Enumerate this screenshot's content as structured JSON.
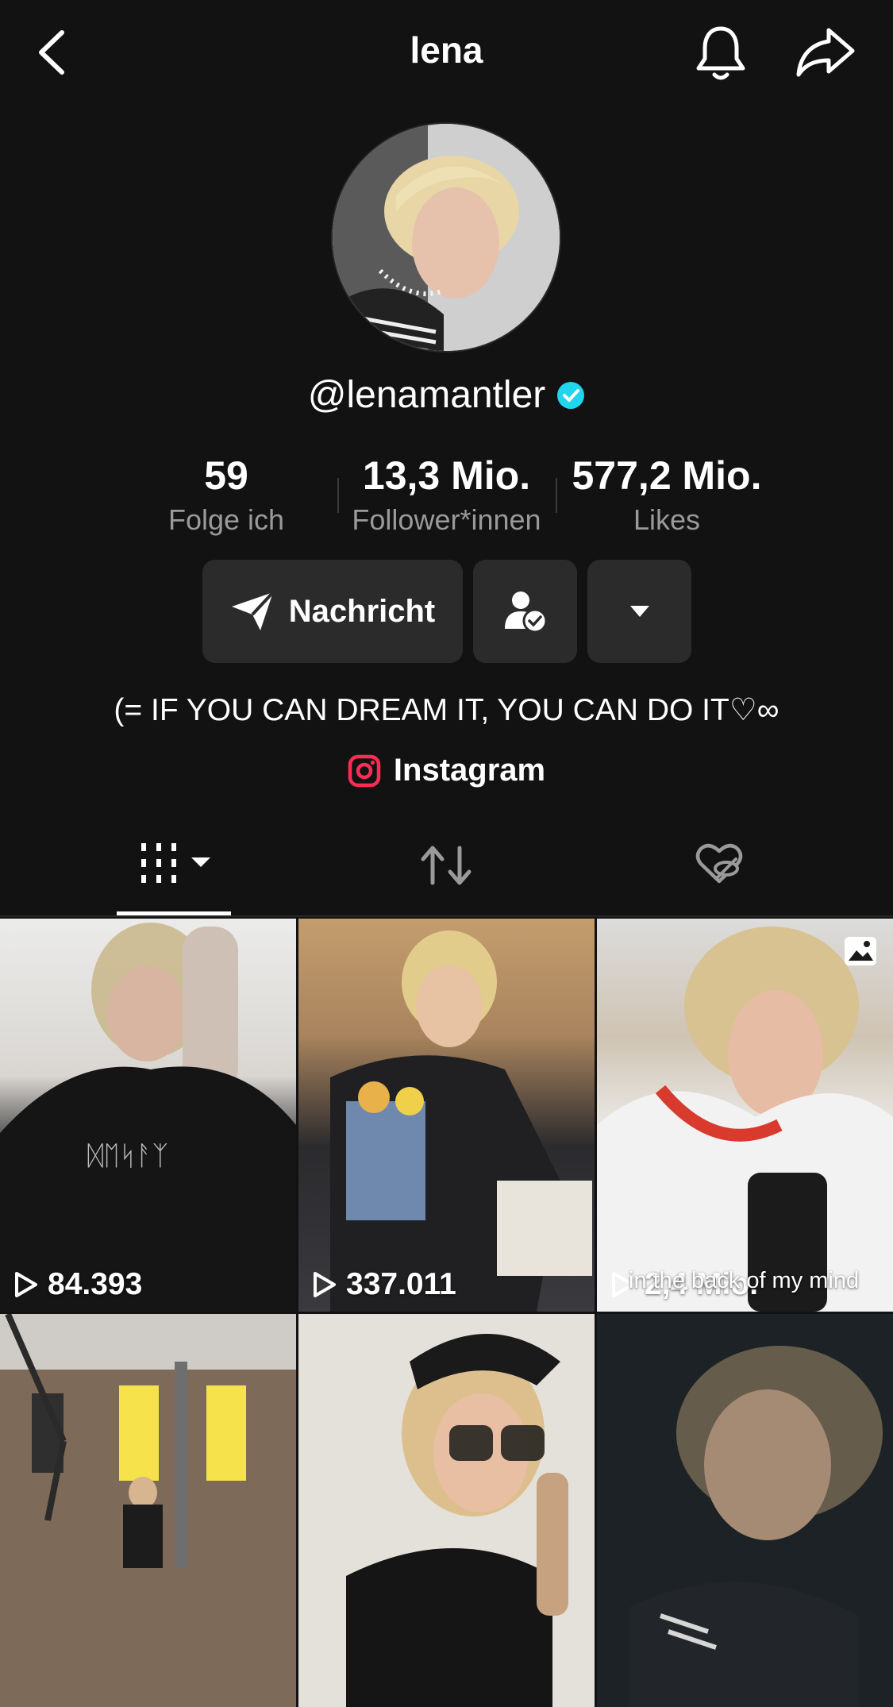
{
  "header": {
    "title": "lena"
  },
  "profile": {
    "handle": "@lenamantler",
    "verified": true,
    "stats": [
      {
        "value": "59",
        "label": "Folge ich"
      },
      {
        "value": "13,3 Mio.",
        "label": "Follower*innen"
      },
      {
        "value": "577,2 Mio.",
        "label": "Likes"
      }
    ],
    "message_button": "Nachricht",
    "bio": "(= IF YOU CAN DREAM IT, YOU CAN DO IT♡∞",
    "link": {
      "label": "Instagram",
      "icon": "instagram-icon"
    }
  },
  "tabs": [
    {
      "icon": "grid-icon",
      "active": true
    },
    {
      "icon": "repost-icon",
      "active": false
    },
    {
      "icon": "liked-hidden-icon",
      "active": false
    }
  ],
  "videos": [
    {
      "views": "84.393"
    },
    {
      "views": "337.011"
    },
    {
      "views": "2,4 Mio.",
      "overlay_text": "in the back of my mind",
      "type": "photo"
    },
    {
      "views": ""
    },
    {
      "views": ""
    },
    {
      "views": ""
    }
  ],
  "colors": {
    "background": "#121212",
    "verified": "#20d5ec",
    "instagram": "#fe2c55",
    "button": "#2b2b2b"
  }
}
